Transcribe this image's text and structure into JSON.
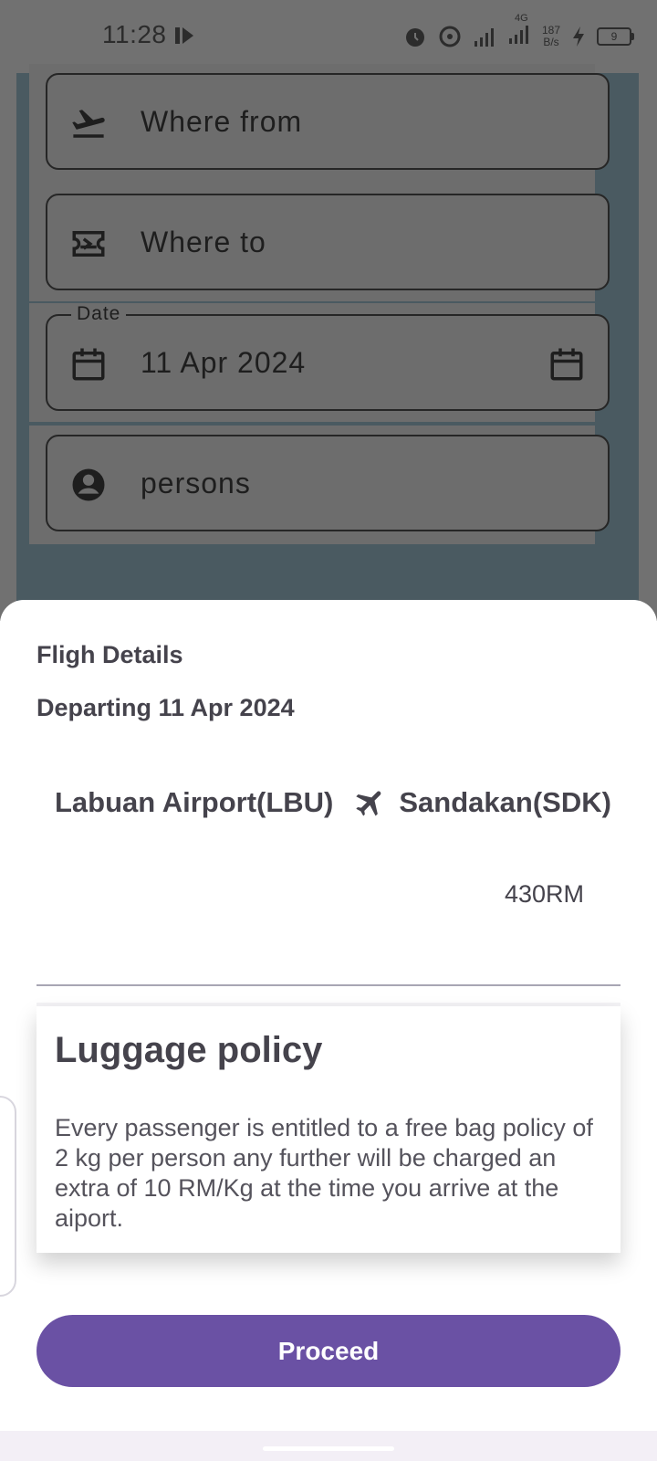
{
  "status_bar": {
    "time": "11:28",
    "net_speed_value": "187",
    "net_speed_unit": "B/s",
    "signal_label": "4G",
    "battery": "9",
    "icons": [
      "media-icon",
      "alarm-icon",
      "hotspot-icon",
      "signal-icon",
      "signal-4g-icon",
      "charging-icon",
      "battery-icon"
    ]
  },
  "form": {
    "from_placeholder": "Where from",
    "to_placeholder": "Where to",
    "date_label": "Date",
    "date_value": "11 Apr 2024",
    "persons_placeholder": "persons"
  },
  "sheet": {
    "title": "Fligh Details",
    "departing": "Departing 11 Apr 2024",
    "from": "Labuan Airport(LBU)",
    "to": "Sandakan(SDK)",
    "price": "430RM",
    "policy_title": "Luggage policy",
    "policy_text": "Every passenger is entitled to a free bag policy of 2 kg per person any further will be charged an extra of 10 RM/Kg at the time you arrive at the aiport.",
    "proceed_label": "Proceed"
  },
  "colors": {
    "accent": "#6a51a4",
    "scrim": "#717171",
    "text": "#45434c"
  }
}
